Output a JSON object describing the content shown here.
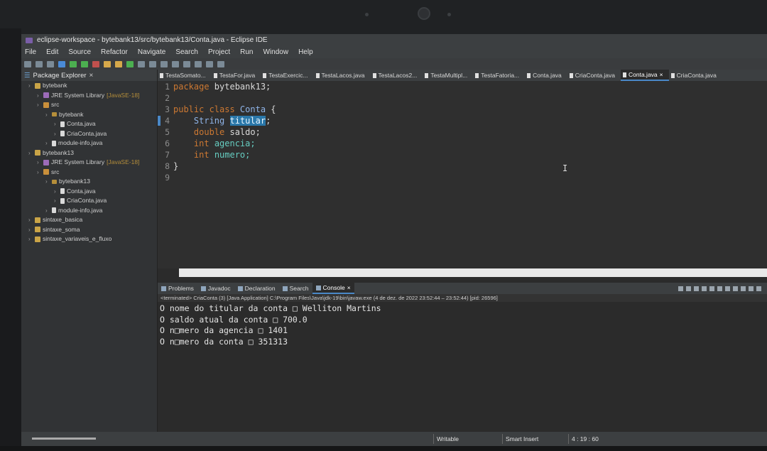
{
  "window": {
    "title": "eclipse-workspace - bytebank13/src/bytebank13/Conta.java - Eclipse IDE"
  },
  "menu": [
    "File",
    "Edit",
    "Source",
    "Refactor",
    "Navigate",
    "Search",
    "Project",
    "Run",
    "Window",
    "Help"
  ],
  "explorer": {
    "title": "Package Explorer",
    "items": [
      {
        "label": "bytebank",
        "indent": 0,
        "icon": "project-icon"
      },
      {
        "label": "JRE System Library",
        "suffix": "[JavaSE-18]",
        "indent": 1,
        "icon": "library-icon"
      },
      {
        "label": "src",
        "indent": 1,
        "icon": "source-folder-icon"
      },
      {
        "label": "bytebank",
        "indent": 2,
        "icon": "package-icon"
      },
      {
        "label": "Conta.java",
        "indent": 3,
        "icon": "java-file-icon"
      },
      {
        "label": "CriaConta.java",
        "indent": 3,
        "icon": "java-file-icon"
      },
      {
        "label": "module-info.java",
        "indent": 2,
        "icon": "java-file-icon"
      },
      {
        "label": "bytebank13",
        "indent": 0,
        "icon": "project-icon"
      },
      {
        "label": "JRE System Library",
        "suffix": "[JavaSE-18]",
        "indent": 1,
        "icon": "library-icon"
      },
      {
        "label": "src",
        "indent": 1,
        "icon": "source-folder-icon"
      },
      {
        "label": "bytebank13",
        "indent": 2,
        "icon": "package-icon"
      },
      {
        "label": "Conta.java",
        "indent": 3,
        "icon": "java-file-icon"
      },
      {
        "label": "CriaConta.java",
        "indent": 3,
        "icon": "java-file-icon"
      },
      {
        "label": "module-info.java",
        "indent": 2,
        "icon": "java-file-icon"
      },
      {
        "label": "sintaxe_basica",
        "indent": 0,
        "icon": "project-icon"
      },
      {
        "label": "sintaxe_soma",
        "indent": 0,
        "icon": "project-icon"
      },
      {
        "label": "sintaxe_variaveis_e_fluxo",
        "indent": 0,
        "icon": "project-icon"
      }
    ]
  },
  "editor_tabs": [
    {
      "label": "TestaSomato..."
    },
    {
      "label": "TestaFor.java"
    },
    {
      "label": "TestaExercic..."
    },
    {
      "label": "TestaLacos.java"
    },
    {
      "label": "TestaLacos2..."
    },
    {
      "label": "TestaMultipl..."
    },
    {
      "label": "TestaFatoria..."
    },
    {
      "label": "Conta.java"
    },
    {
      "label": "CriaConta.java"
    },
    {
      "label": "Conta.java",
      "active": true,
      "closable": true
    },
    {
      "label": "CriaConta.java"
    }
  ],
  "code_lines": [
    {
      "n": "1",
      "tokens": [
        {
          "t": "package ",
          "c": "kw"
        },
        {
          "t": "bytebank13;",
          "c": ""
        }
      ]
    },
    {
      "n": "2",
      "tokens": []
    },
    {
      "n": "3",
      "tokens": [
        {
          "t": "public class ",
          "c": "kw"
        },
        {
          "t": "Conta",
          "c": "cls"
        },
        {
          "t": " {",
          "c": ""
        }
      ]
    },
    {
      "n": "4",
      "tokens": [
        {
          "t": "    ",
          "c": ""
        },
        {
          "t": "String",
          "c": "cls"
        },
        {
          "t": " ",
          "c": ""
        },
        {
          "t": "titular",
          "c": "sel"
        },
        {
          "t": ";",
          "c": ""
        }
      ],
      "marked": true
    },
    {
      "n": "5",
      "tokens": [
        {
          "t": "    ",
          "c": ""
        },
        {
          "t": "double ",
          "c": "kw"
        },
        {
          "t": "saldo;",
          "c": ""
        }
      ]
    },
    {
      "n": "6",
      "tokens": [
        {
          "t": "    ",
          "c": ""
        },
        {
          "t": "int ",
          "c": "kw"
        },
        {
          "t": "agencia;",
          "c": "fld"
        }
      ]
    },
    {
      "n": "7",
      "tokens": [
        {
          "t": "    ",
          "c": ""
        },
        {
          "t": "int ",
          "c": "kw"
        },
        {
          "t": "numero;",
          "c": "fld"
        }
      ]
    },
    {
      "n": "8",
      "tokens": [
        {
          "t": "}",
          "c": ""
        }
      ]
    },
    {
      "n": "9",
      "tokens": []
    }
  ],
  "console_tabs": [
    {
      "label": "Problems",
      "icon": "problems-icon"
    },
    {
      "label": "Javadoc",
      "icon": "javadoc-icon"
    },
    {
      "label": "Declaration",
      "icon": "declaration-icon"
    },
    {
      "label": "Search",
      "icon": "search-icon"
    },
    {
      "label": "Console",
      "icon": "console-icon",
      "active": true,
      "closable": true
    }
  ],
  "console": {
    "terminated": "<terminated> CriaConta (3) [Java Application] C:\\Program Files\\Java\\jdk-19\\bin\\javaw.exe  (4 de dez. de 2022 23:52:44 – 23:52:44) [pid: 26596]",
    "lines": [
      "O nome do titular da conta □ Welliton Martins",
      "O saldo atual da conta □ 700.0",
      "O n□mero da agencia □ 1401",
      "O n□mero da conta □ 351313"
    ]
  },
  "status": {
    "writable": "Writable",
    "insert_mode": "Smart Insert",
    "position": "4 : 19 : 60"
  }
}
